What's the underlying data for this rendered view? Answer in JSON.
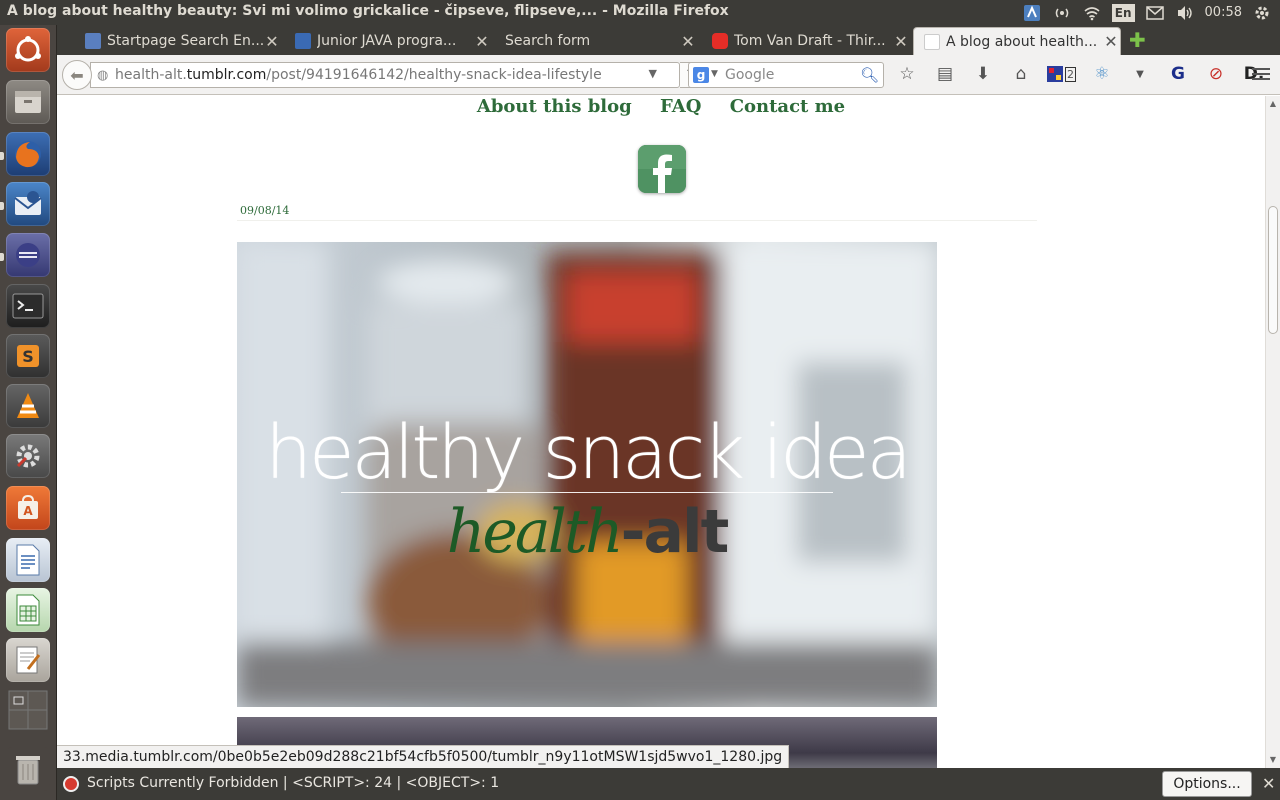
{
  "window": {
    "title": "A blog about healthy beauty: Svi mi volimo grickalice - čipseve, flipseve,... - Mozilla Firefox"
  },
  "system_tray": {
    "language": "En",
    "clock": "00:58"
  },
  "launcher": {
    "items": [
      "Ubuntu Dash",
      "Files",
      "Firefox",
      "Thunderbird",
      "Eclipse",
      "Terminal",
      "Sublime Text",
      "VLC",
      "System Settings",
      "Ubuntu Software Center",
      "LibreOffice Writer",
      "LibreOffice Calc",
      "Text Editor",
      "Workspaces",
      "Trash"
    ]
  },
  "tabs": [
    {
      "label": "Startpage Search En...",
      "active": false
    },
    {
      "label": "Junior JAVA progra...",
      "active": false
    },
    {
      "label": "Search form",
      "active": false
    },
    {
      "label": "Tom Van Draft - Thir...",
      "active": false
    },
    {
      "label": "A blog about health...",
      "active": true
    }
  ],
  "navbar": {
    "url_prefix": "health-alt.",
    "url_host": "tumblr.com",
    "url_path": "/post/94191646142/healthy-snack-idea-lifestyle",
    "search_placeholder": "Google",
    "addon_badge": "2"
  },
  "page": {
    "nav": [
      "About this blog",
      "FAQ",
      "Contact me"
    ],
    "date": "09/08/14",
    "hero": {
      "title": "healthy snack idea",
      "logo_green": "health",
      "logo_dark": "-alt"
    }
  },
  "status_link": "33.media.tumblr.com/0be0b5e2eb09d288c21bf54cfb5f0500/tumblr_n9y11otMSW1sjd5wvo1_1280.jpg",
  "noscript": {
    "message": "Scripts Currently Forbidden | <SCRIPT>: 24 | <OBJECT>: 1",
    "options_label": "Options..."
  },
  "colors": {
    "accent_green": "#2e6b3a",
    "panel_dark": "#3c3b37",
    "launcher_bg": "#4a4541"
  }
}
